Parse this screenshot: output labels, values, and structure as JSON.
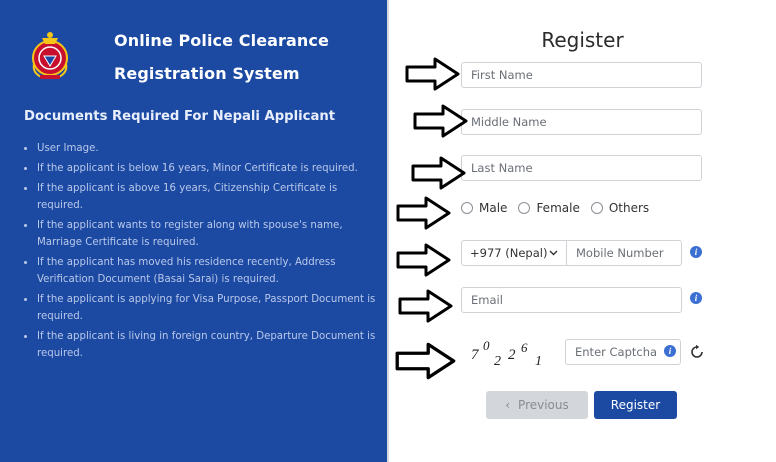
{
  "brand": {
    "line1": "Online Police Clearance",
    "line2": "Registration System",
    "logo_icon": "nepal-police-emblem-icon"
  },
  "documents": {
    "heading": "Documents Required For Nepali Applicant",
    "items": [
      "User Image.",
      "If the applicant is below 16 years, Minor Certificate is required.",
      "If the applicant is above 16 years, Citizenship Certificate is required.",
      "If the applicant wants to register along with spouse's name, Marriage Certificate is required.",
      "If the applicant has moved his residence recently, Address Verification Document (Basai Sarai) is required.",
      "If the applicant is applying for Visa Purpose, Passport Document is required.",
      "If the applicant is living in foreign country, Departure Document is required."
    ]
  },
  "form": {
    "title": "Register",
    "first_name_placeholder": "First Name",
    "middle_name_placeholder": "Middle Name",
    "last_name_placeholder": "Last Name",
    "gender_options": [
      "Male",
      "Female",
      "Others"
    ],
    "country_code": "+977 (Nepal)",
    "mobile_placeholder": "Mobile Number",
    "email_placeholder": "Email",
    "captcha_text": "702261",
    "captcha_placeholder": "Enter Captcha",
    "previous_label": "Previous",
    "register_label": "Register"
  },
  "colors": {
    "panel_blue": "#1c4aa3",
    "info_blue": "#3b6fd1"
  }
}
